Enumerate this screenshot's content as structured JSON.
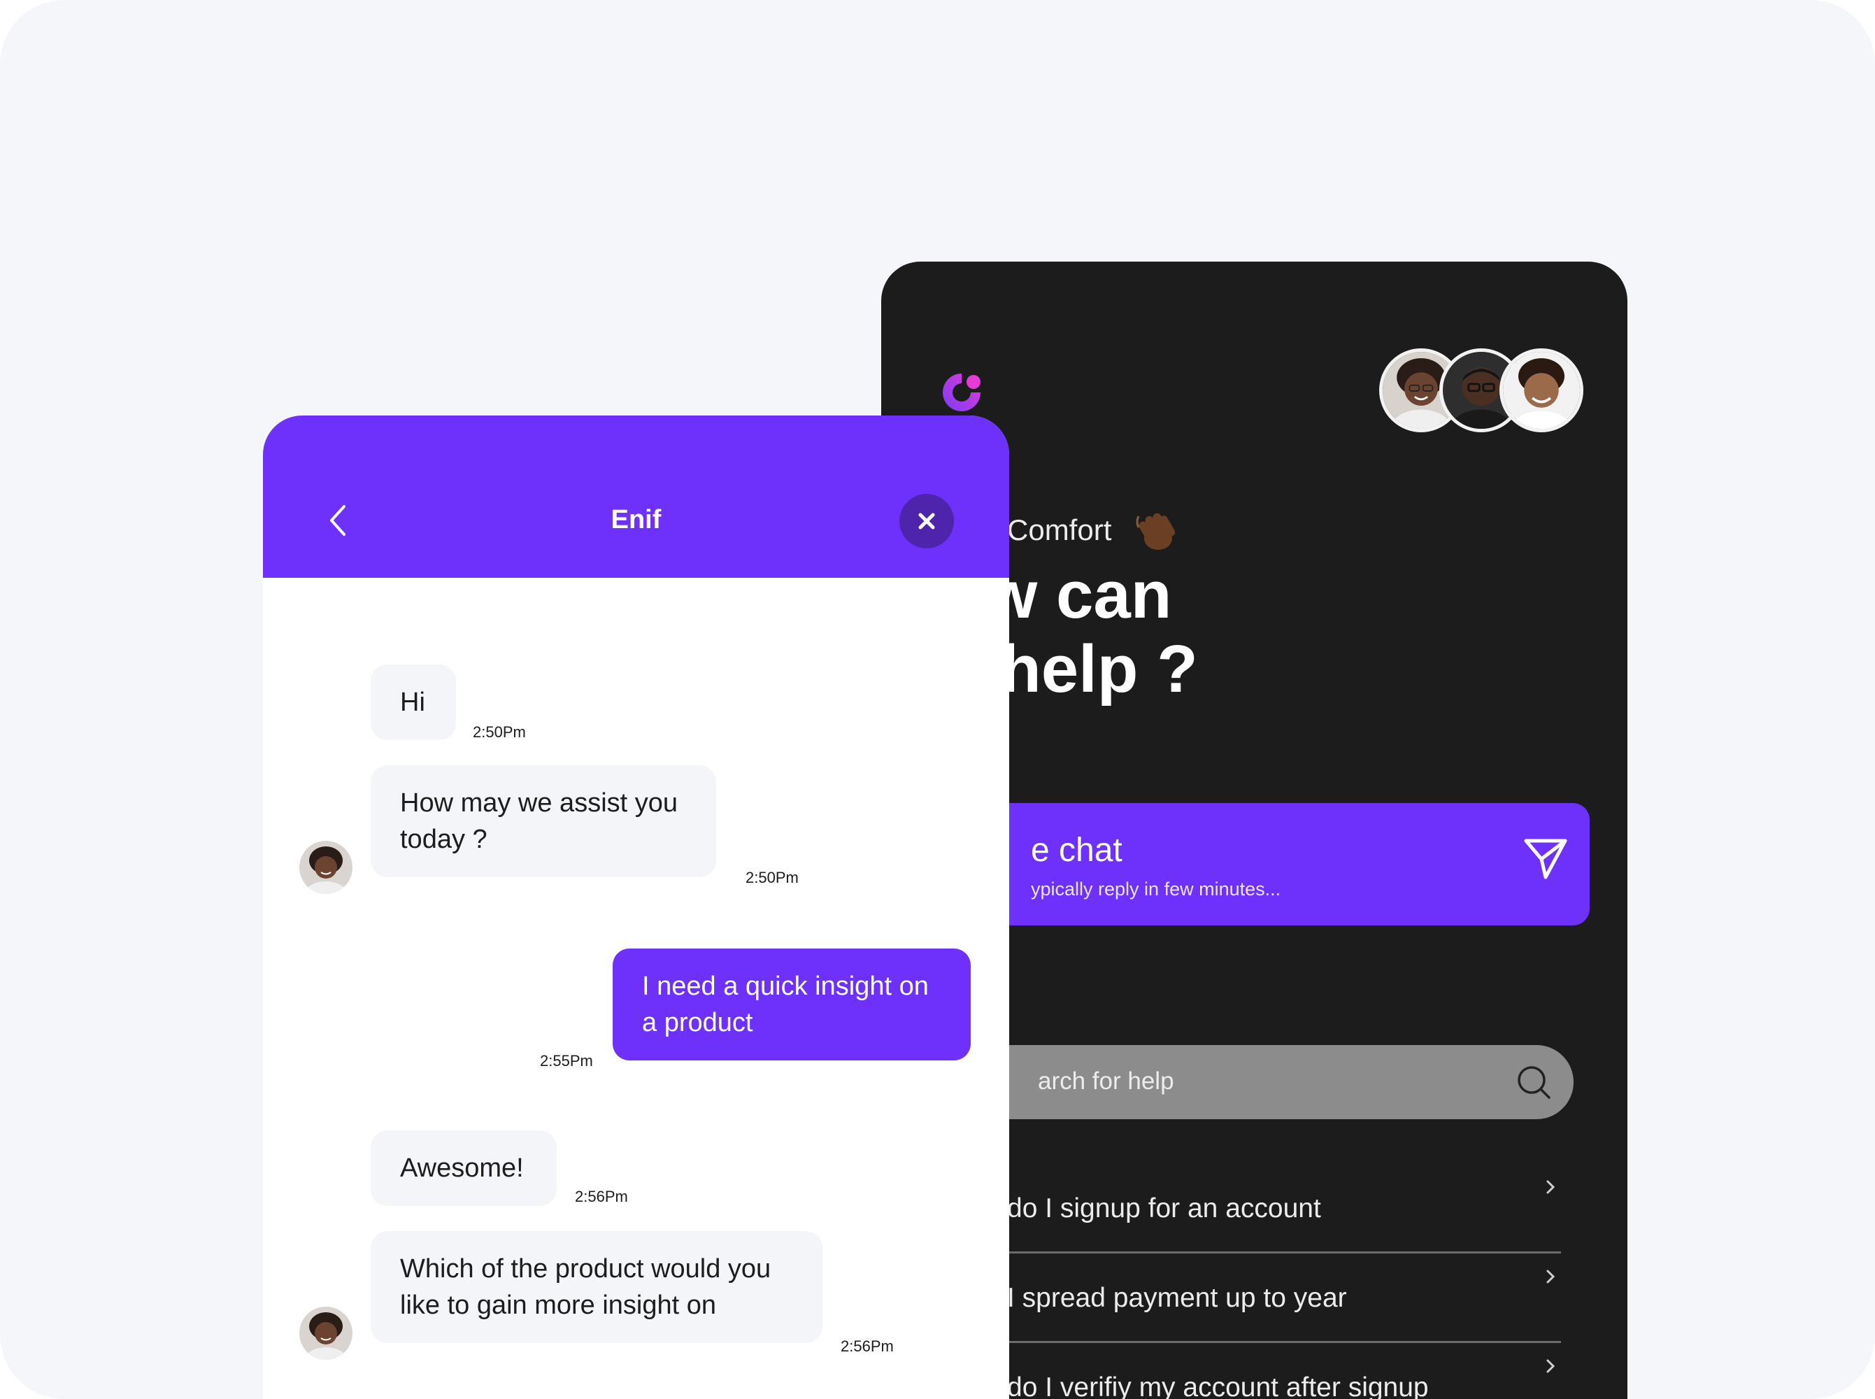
{
  "colors": {
    "accent": "#6e30fb",
    "dark_panel": "#1c1c1c",
    "page_bg": "#f5f6fa",
    "incoming_bubble": "#f4f5f9",
    "close_button": "#4f24ad",
    "logo_gradient": [
      "#7b3cf7",
      "#e63bd6"
    ]
  },
  "help_widget": {
    "logo_icon": "brand-logo-icon",
    "avatars": [
      "agent-avatar-1",
      "agent-avatar-2",
      "agent-avatar-3"
    ],
    "greeting": "Comfort",
    "greeting_emoji": "waving-hand-emoji",
    "headline_line1": "ow can",
    "headline_line2": "e help ?",
    "live_chat": {
      "title": "e chat",
      "subtitle": "ypically reply in few minutes...",
      "icon": "send-icon"
    },
    "search": {
      "placeholder": "arch for help",
      "icon": "search-icon"
    },
    "faqs": [
      {
        "label": "do I signup for an account"
      },
      {
        "label": "I spread payment up to year"
      },
      {
        "label": "do I verifiy my account after signup"
      }
    ]
  },
  "chat_window": {
    "header": {
      "title": "Enif",
      "back_icon": "chevron-left-icon",
      "close_icon": "close-icon"
    },
    "messages": [
      {
        "direction": "incoming",
        "text": "Hi",
        "time": "2:50Pm"
      },
      {
        "direction": "incoming",
        "text": "How may we assist you today ?",
        "time": "2:50Pm"
      },
      {
        "direction": "outgoing",
        "text": "I need a quick insight on a product",
        "time": "2:55Pm"
      },
      {
        "direction": "incoming",
        "text": "Awesome!",
        "time": "2:56Pm"
      },
      {
        "direction": "incoming",
        "text": "Which of the product would you like to gain more insight on",
        "time": "2:56Pm"
      }
    ]
  }
}
